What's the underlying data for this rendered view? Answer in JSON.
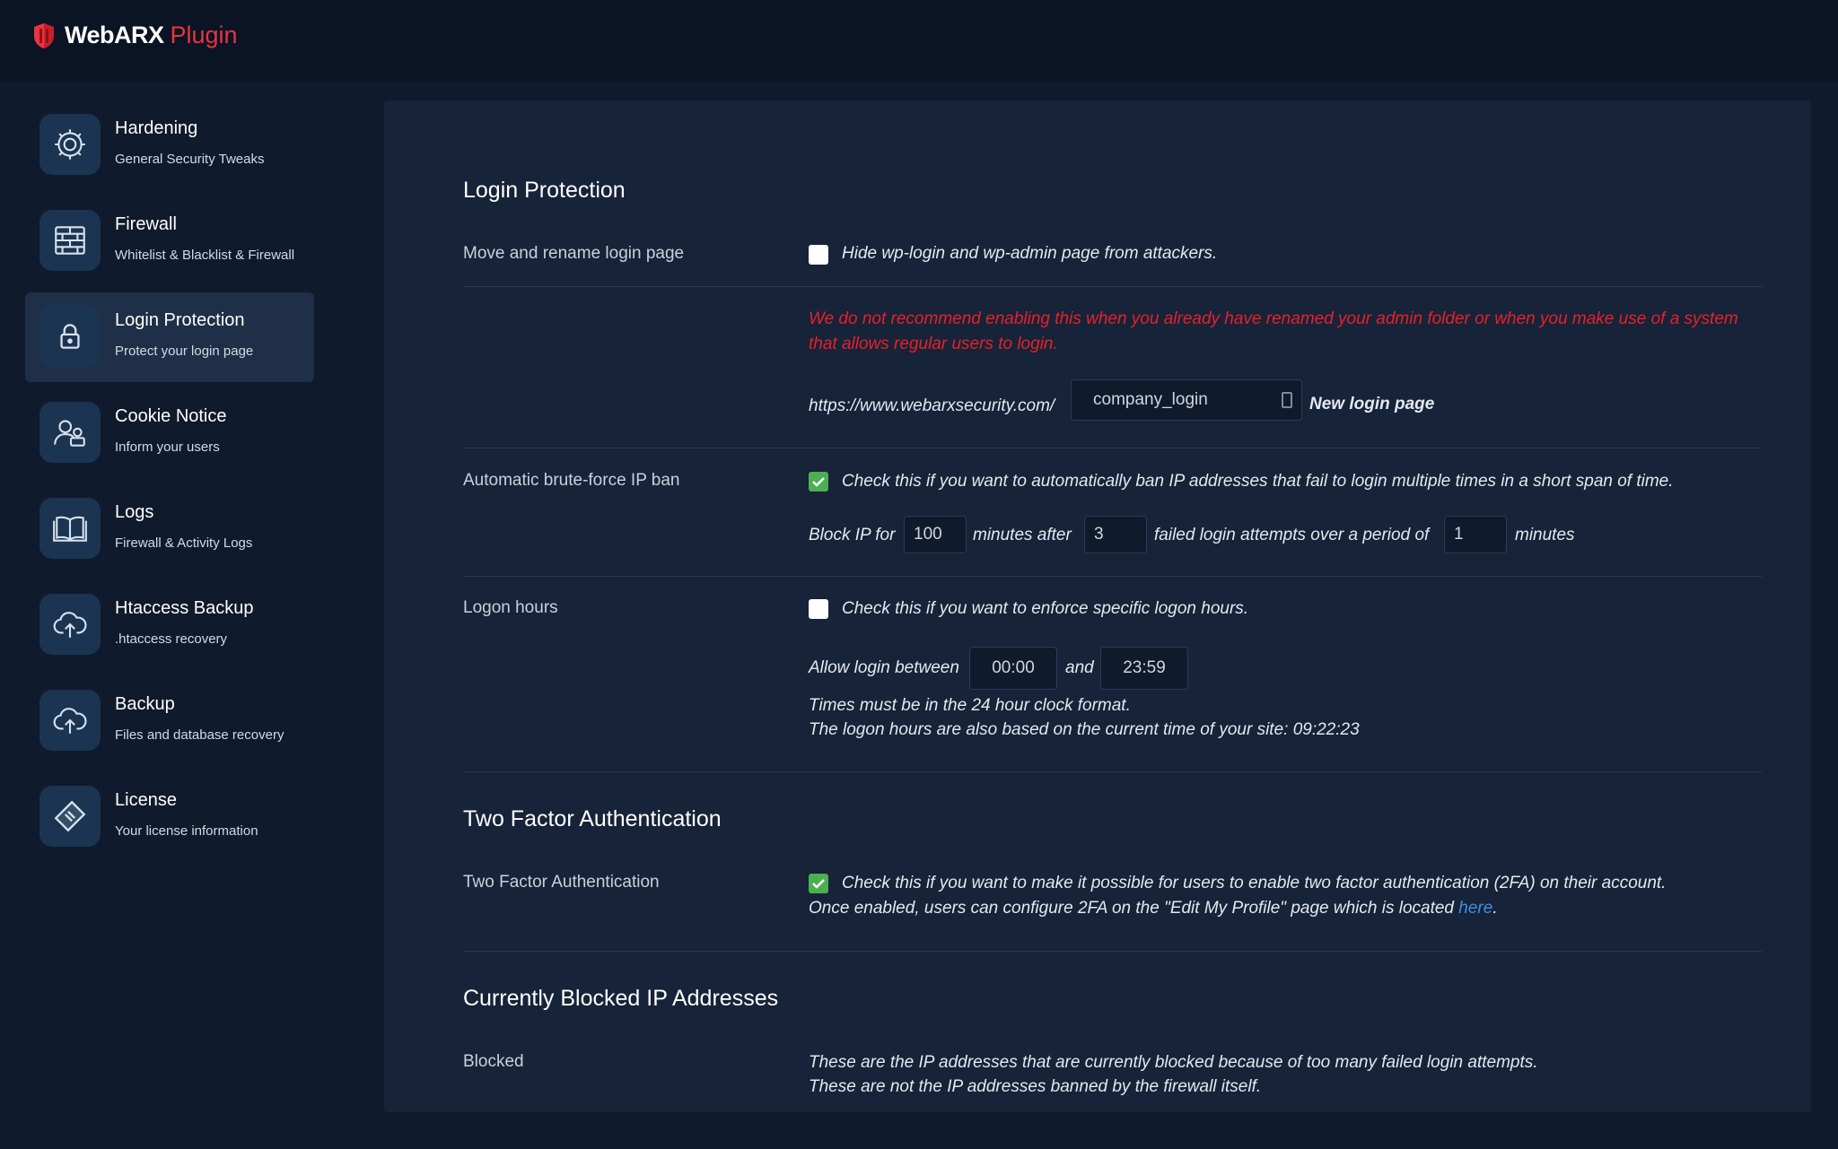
{
  "app": {
    "logo_name": "WebARX",
    "logo_accent": "Plugin",
    "brand_color": "#e8343f",
    "accent_color": "#3f8fe6",
    "check_color": "#4caf50",
    "warning_color": "#e8202a"
  },
  "sidebar": {
    "items": [
      {
        "title": "Hardening",
        "subtitle": "General Security Tweaks",
        "icon": "gear-icon",
        "active": false
      },
      {
        "title": "Firewall",
        "subtitle": "Whitelist & Blacklist & Firewall",
        "icon": "brick-wall-icon",
        "active": false
      },
      {
        "title": "Login Protection",
        "subtitle": "Protect your login page",
        "icon": "lock-icon",
        "active": true
      },
      {
        "title": "Cookie Notice",
        "subtitle": "Inform your users",
        "icon": "users-icon",
        "active": false
      },
      {
        "title": "Logs",
        "subtitle": "Firewall & Activity Logs",
        "icon": "book-icon",
        "active": false
      },
      {
        "title": "Htaccess Backup",
        "subtitle": ".htaccess recovery",
        "icon": "cloud-upload-icon",
        "active": false
      },
      {
        "title": "Backup",
        "subtitle": "Files and database recovery",
        "icon": "cloud-upload-icon",
        "active": false
      },
      {
        "title": "License",
        "subtitle": "Your license information",
        "icon": "ticket-icon",
        "active": false
      }
    ]
  },
  "login_protection": {
    "title": "Login Protection",
    "rename": {
      "label": "Move and rename login page",
      "checkbox_text": "Hide wp-login and wp-admin page from attackers.",
      "checked": false,
      "warning": "We do not recommend enabling this when you already have renamed your admin folder or when you make use of a system that allows regular users to login.",
      "url_prefix": "https://www.webarxsecurity.com/",
      "slug_value": "company_login",
      "slug_suffix": "New login page"
    },
    "bruteforce": {
      "label": "Automatic brute-force IP ban",
      "checkbox_text": "Check this if you want to automatically ban IP addresses that fail to login multiple times in a short span of time.",
      "checked": true,
      "block_for_label": "Block IP for",
      "block_minutes": "100",
      "minutes_after_label": "minutes after",
      "attempts": "3",
      "attempts_label": "failed login attempts over a period of",
      "period": "1",
      "minutes_label": "minutes"
    },
    "logon_hours": {
      "label": "Logon hours",
      "checkbox_text": "Check this if you want to enforce specific logon hours.",
      "checked": false,
      "allow_label": "Allow login between",
      "start": "00:00",
      "and_label": "and",
      "end": "23:59",
      "note1": "Times must be in the 24 hour clock format.",
      "note2": "The logon hours are also based on the current time of your site: 09:22:23"
    }
  },
  "two_factor": {
    "title": "Two Factor Authentication",
    "label": "Two Factor Authentication",
    "checked": true,
    "checkbox_text": "Check this if you want to make it possible for users to enable two factor authentication (2FA) on their account.",
    "note_prefix": "Once enabled, users can configure 2FA on the \"Edit My Profile\" page which is located here ",
    "note_link": "here",
    "note_suffix": "."
  },
  "blocked": {
    "title": "Currently Blocked IP Addresses",
    "label": "Blocked",
    "note1": "These are the IP addresses that are currently blocked because of too many failed login attempts.",
    "note2": "These are not the IP addresses banned by the firewall itself."
  }
}
